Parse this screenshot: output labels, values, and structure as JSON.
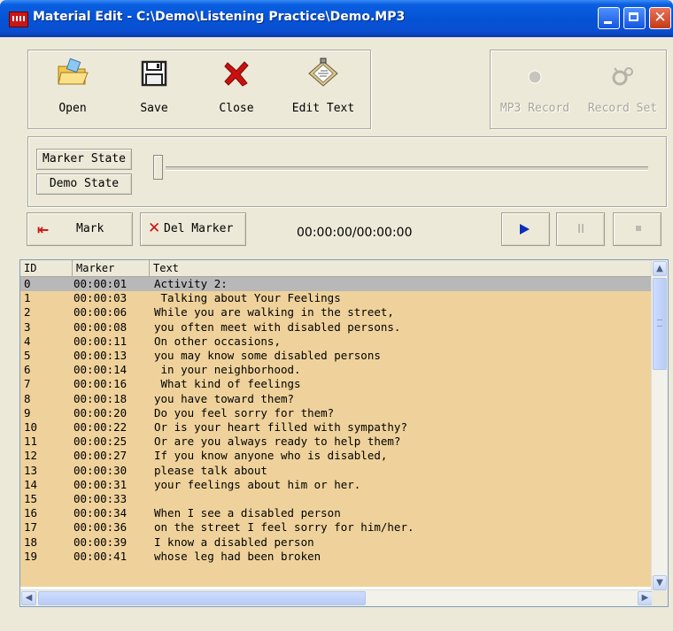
{
  "window": {
    "title": "Material Edit - C:\\Demo\\Listening Practice\\Demo.MP3",
    "close_glyph": "✕"
  },
  "toolbar": {
    "open_label": "Open",
    "save_label": "Save",
    "close_label": "Close",
    "edit_text_label": "Edit Text",
    "mp3_record_label": "MP3 Record",
    "record_set_label": "Record Set"
  },
  "state": {
    "marker_state_label": "Marker State",
    "demo_state_label": "Demo State",
    "slider_position": 0
  },
  "transport": {
    "mark_label": "Mark",
    "del_marker_label": "Del Marker",
    "time": "00:00:00/00:00:00"
  },
  "list": {
    "columns": [
      "ID",
      "Marker",
      "Text"
    ],
    "selected_index": 0,
    "rows": [
      {
        "id": "0",
        "marker": "00:00:01",
        "text": "Activity 2:"
      },
      {
        "id": "1",
        "marker": "00:00:03",
        "text": " Talking about Your Feelings"
      },
      {
        "id": "2",
        "marker": "00:00:06",
        "text": "While you are walking in the street,"
      },
      {
        "id": "3",
        "marker": "00:00:08",
        "text": "you often meet with disabled persons."
      },
      {
        "id": "4",
        "marker": "00:00:11",
        "text": "On other occasions,"
      },
      {
        "id": "5",
        "marker": "00:00:13",
        "text": "you may know some disabled persons"
      },
      {
        "id": "6",
        "marker": "00:00:14",
        "text": " in your neighborhood."
      },
      {
        "id": "7",
        "marker": "00:00:16",
        "text": " What kind of feelings"
      },
      {
        "id": "8",
        "marker": "00:00:18",
        "text": "you have toward them?"
      },
      {
        "id": "9",
        "marker": "00:00:20",
        "text": "Do you feel sorry for them?"
      },
      {
        "id": "10",
        "marker": "00:00:22",
        "text": "Or is your heart filled with sympathy?"
      },
      {
        "id": "11",
        "marker": "00:00:25",
        "text": "Or are you always ready to help them?"
      },
      {
        "id": "12",
        "marker": "00:00:27",
        "text": "If you know anyone who is disabled,"
      },
      {
        "id": "13",
        "marker": "00:00:30",
        "text": "please talk about"
      },
      {
        "id": "14",
        "marker": "00:00:31",
        "text": "your feelings about him or her."
      },
      {
        "id": "15",
        "marker": "00:00:33",
        "text": ""
      },
      {
        "id": "16",
        "marker": "00:00:34",
        "text": "When I see a disabled person"
      },
      {
        "id": "17",
        "marker": "00:00:36",
        "text": "on the street I feel sorry for him/her."
      },
      {
        "id": "18",
        "marker": "00:00:39",
        "text": "I know a disabled person"
      },
      {
        "id": "19",
        "marker": "00:00:41",
        "text": "whose leg had been broken"
      }
    ]
  },
  "colors": {
    "row_background": "#efd29b",
    "selected_row": "#b8b8b8",
    "titlebar": "#0553d6"
  },
  "icons": {
    "open": "folder-open-icon",
    "save": "floppy-disk-icon",
    "close": "red-x-icon",
    "edit_text": "clipboard-pencil-icon",
    "mp3_record": "record-dot-icon",
    "record_set": "settings-icon"
  }
}
